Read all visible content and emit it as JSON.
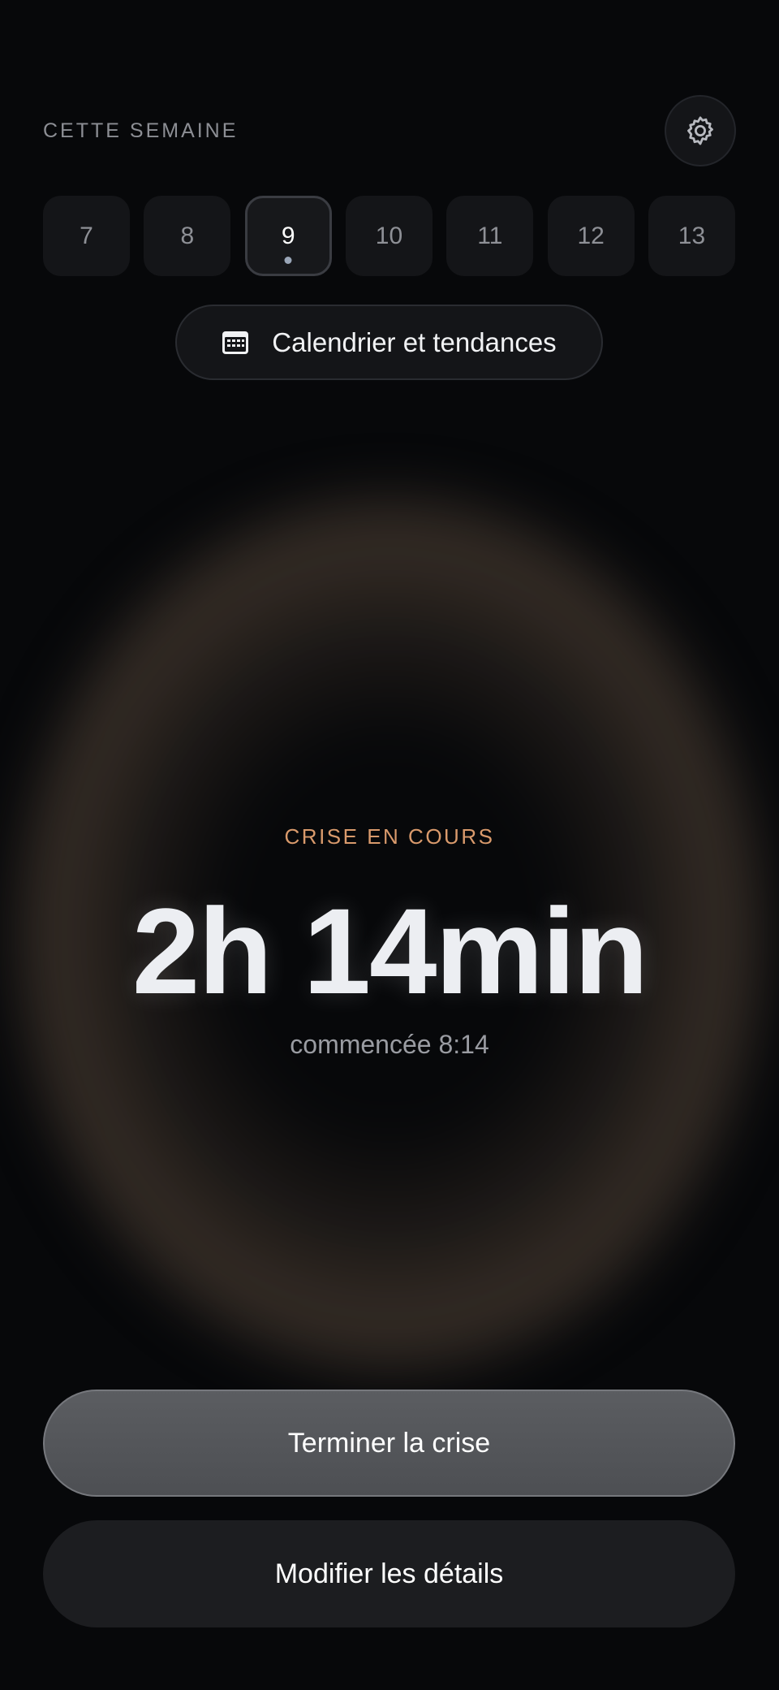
{
  "week": {
    "label": "CETTE SEMAINE",
    "days": [
      {
        "label": "7"
      },
      {
        "label": "8"
      },
      {
        "label": "9",
        "selected": true,
        "has_event": true
      },
      {
        "label": "10"
      },
      {
        "label": "11"
      },
      {
        "label": "12"
      },
      {
        "label": "13"
      }
    ]
  },
  "settings": {
    "icon": "gear-icon"
  },
  "calendar_button": {
    "label": "Calendrier et tendances",
    "icon": "calendar-icon"
  },
  "episode": {
    "status": "CRISE EN COURS",
    "duration": "2h 14min",
    "started": "commencée 8:14"
  },
  "actions": {
    "end_label": "Terminer la crise",
    "edit_label": "Modifier les détails"
  },
  "colors": {
    "accent": "#d99a6c",
    "background": "#07080a"
  }
}
